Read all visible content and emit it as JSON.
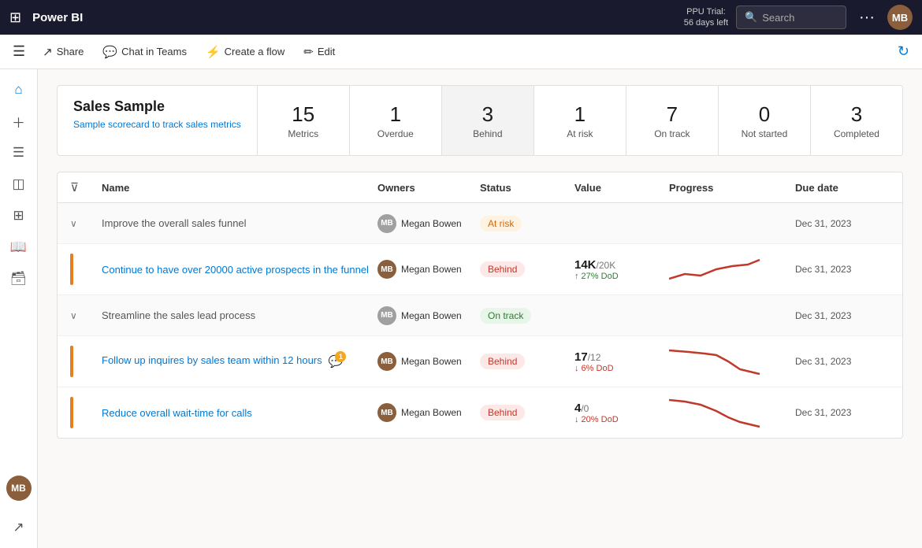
{
  "topnav": {
    "waffle_icon": "⊞",
    "logo": "Power BI",
    "trial_line1": "PPU Trial:",
    "trial_line2": "56 days left",
    "search_placeholder": "Search",
    "dots": "···",
    "avatar_initials": "MB"
  },
  "toolbar": {
    "hamburger_icon": "☰",
    "share_label": "Share",
    "share_icon": "↗",
    "chat_label": "Chat in Teams",
    "chat_icon": "💬",
    "flow_label": "Create a flow",
    "flow_icon": "⚡",
    "edit_label": "Edit",
    "edit_icon": "✏",
    "refresh_icon": "↻"
  },
  "sidebar": {
    "icons": [
      "⌂",
      "+",
      "☰",
      "☁",
      "⊞",
      "📖",
      "🖥",
      "↗"
    ],
    "avatar": "MB"
  },
  "scorecard": {
    "title": "Sales Sample",
    "subtitle": "Sample scorecard to track sales metrics",
    "metrics": [
      {
        "number": "15",
        "label": "Metrics"
      },
      {
        "number": "1",
        "label": "Overdue"
      },
      {
        "number": "3",
        "label": "Behind",
        "active": true
      },
      {
        "number": "1",
        "label": "At risk"
      },
      {
        "number": "7",
        "label": "On track"
      },
      {
        "number": "0",
        "label": "Not started"
      },
      {
        "number": "3",
        "label": "Completed"
      }
    ]
  },
  "table": {
    "headers": [
      "",
      "Name",
      "Owners",
      "Status",
      "Value",
      "Progress",
      "Due date"
    ],
    "rows": [
      {
        "type": "parent",
        "name": "Improve the overall sales funnel",
        "owner": "Megan Bowen",
        "owner_gray": true,
        "status": "At risk",
        "status_class": "status-at-risk",
        "value": "",
        "value_sub": "",
        "due_date": "Dec 31, 2023",
        "has_chevron": true,
        "has_bar": false
      },
      {
        "type": "child",
        "name": "Continue to have over 20000 active prospects in the funnel",
        "owner": "Megan Bowen",
        "owner_gray": false,
        "status": "Behind",
        "status_class": "status-behind",
        "value": "14K",
        "value_denom": "/20K",
        "value_sub": "↑ 27% DoD",
        "value_up": true,
        "due_date": "Dec 31, 2023",
        "has_chevron": false,
        "has_bar": true,
        "chart": "up_then_flat"
      },
      {
        "type": "parent",
        "name": "Streamline the sales lead process",
        "owner": "Megan Bowen",
        "owner_gray": true,
        "status": "On track",
        "status_class": "status-on-track",
        "value": "",
        "value_sub": "",
        "due_date": "Dec 31, 2023",
        "has_chevron": true,
        "has_bar": false
      },
      {
        "type": "child",
        "name": "Follow up inquires by sales team within 12 hours",
        "owner": "Megan Bowen",
        "owner_gray": false,
        "status": "Behind",
        "status_class": "status-behind",
        "value": "17",
        "value_denom": "/12",
        "value_sub": "↓ 6% DoD",
        "value_up": false,
        "due_date": "Dec 31, 2023",
        "has_chevron": false,
        "has_bar": true,
        "has_notif": true,
        "chart": "down_steep"
      },
      {
        "type": "child",
        "name": "Reduce overall wait-time for calls",
        "owner": "Megan Bowen",
        "owner_gray": false,
        "status": "Behind",
        "status_class": "status-behind",
        "value": "4",
        "value_denom": "/0",
        "value_sub": "↓ 20% DoD",
        "value_up": false,
        "due_date": "Dec 31, 2023",
        "has_chevron": false,
        "has_bar": true,
        "chart": "down_steep2"
      }
    ]
  }
}
